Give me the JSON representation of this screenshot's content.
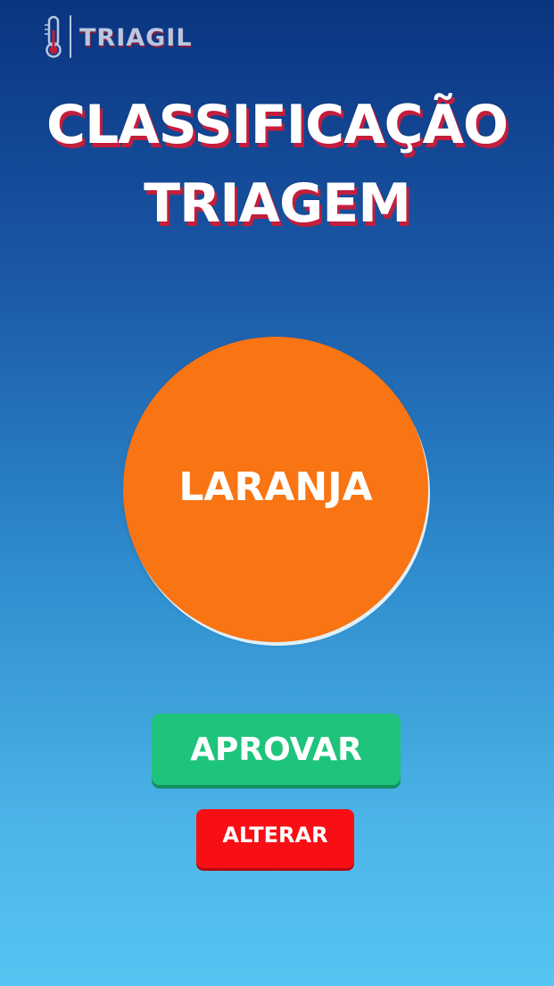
{
  "app": {
    "logo_text": "TRIAGIL"
  },
  "header": {
    "title_line1": "CLASSIFICAÇÃO",
    "title_line2": "TRIAGEM"
  },
  "classification": {
    "label": "LARANJA",
    "color": "#f97412"
  },
  "actions": {
    "approve_label": "APROVAR",
    "approve_color": "#1ec47c",
    "alter_label": "ALTERAR",
    "alter_color": "#f80f15"
  },
  "icons": {
    "logo_icon": "thermometer-icon"
  }
}
